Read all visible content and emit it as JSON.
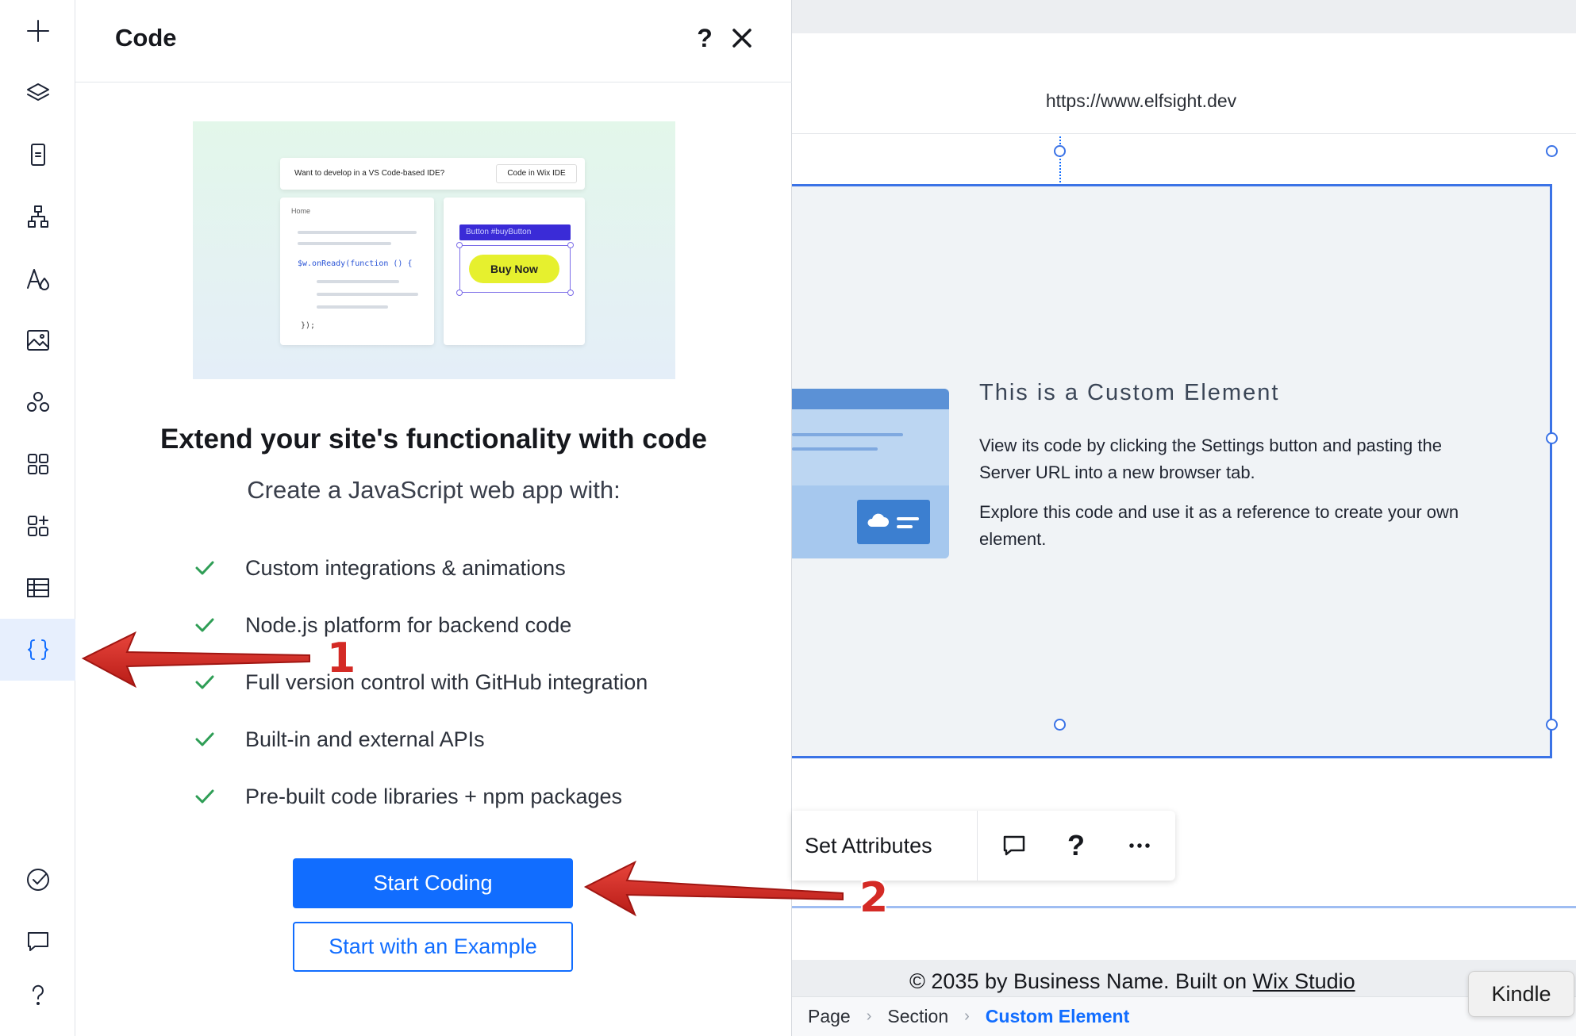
{
  "rail": {
    "items": [
      {
        "icon": "plus-icon"
      },
      {
        "icon": "layers-icon"
      },
      {
        "icon": "page-icon"
      },
      {
        "icon": "sitemap-icon"
      },
      {
        "icon": "typography-icon"
      },
      {
        "icon": "image-icon"
      },
      {
        "icon": "apps-icon"
      },
      {
        "icon": "grid-icon"
      },
      {
        "icon": "add-apps-icon"
      },
      {
        "icon": "table-icon"
      },
      {
        "icon": "code-braces-icon",
        "active": true
      },
      {
        "icon": "check-circle-icon"
      },
      {
        "icon": "chat-icon"
      },
      {
        "icon": "question-icon"
      }
    ]
  },
  "panel": {
    "title": "Code",
    "help": "?",
    "illustration": {
      "bar_text": "Want to develop in a VS Code-based IDE?",
      "bar_button": "Code in Wix IDE",
      "home": "Home",
      "code_fn": "$w.onReady(function () {",
      "code_end": "});",
      "tag": "Button #buyButton",
      "buy": "Buy Now"
    },
    "headline": "Extend your site's functionality with code",
    "subhead": "Create a JavaScript web app with:",
    "features": [
      "Custom integrations & animations",
      "Node.js platform for backend code",
      "Full version control with GitHub integration",
      "Built-in and external APIs",
      "Pre-built code libraries + npm packages"
    ],
    "primary_button": "Start Coding",
    "secondary_button": "Start with an Example"
  },
  "canvas": {
    "url": "https://www.elfsight.dev",
    "custom_element": {
      "title": "This is a Custom Element",
      "paragraph1": "View its code by clicking the Settings button and pasting the Server URL into a new browser tab.",
      "paragraph2": "Explore this code and use it as a reference to create your own element."
    },
    "toolbar": {
      "set_attributes": "Set Attributes",
      "question": "?"
    },
    "footer": {
      "text": "© 2035 by Business Name. Built on ",
      "link": "Wix Studio"
    },
    "breadcrumb": [
      "Page",
      "Section",
      "Custom Element"
    ],
    "kindle_tooltip": "Kindle"
  },
  "annotations": {
    "label1": "1",
    "label2": "2"
  },
  "colors": {
    "accent": "#116dff",
    "check": "#2f9e56",
    "annotation": "#d42a25",
    "selection": "#3b73e6"
  }
}
